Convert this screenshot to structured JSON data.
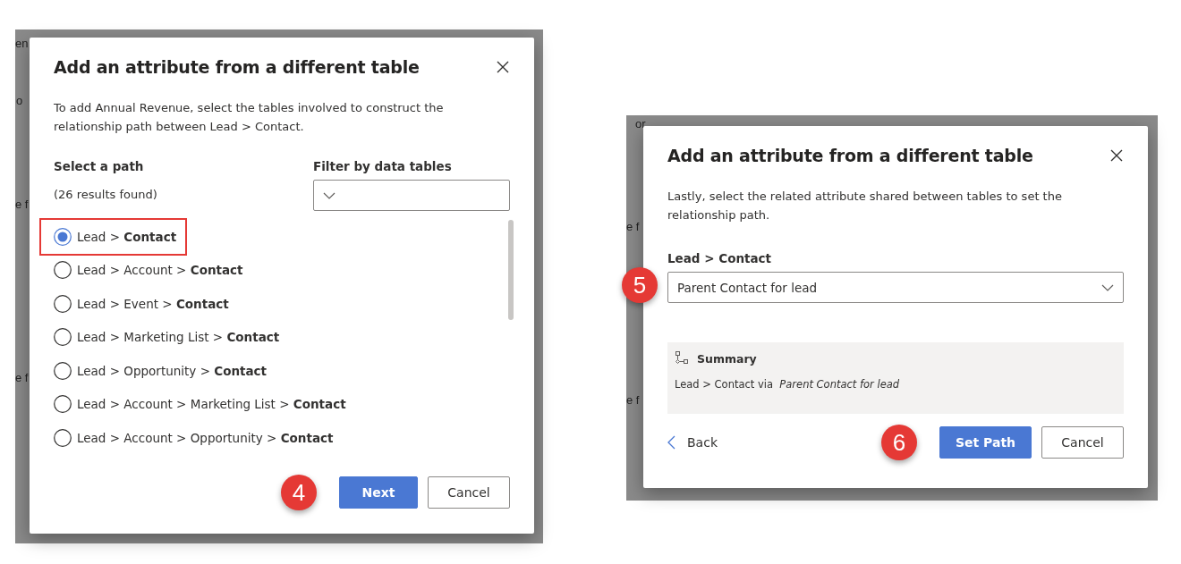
{
  "step_one": {
    "backdrop": {
      "fragments": [
        "en",
        "o",
        "e f",
        "e f"
      ]
    },
    "dialog": {
      "title": "Add an attribute from a different table",
      "description": "To add Annual Revenue, select the tables involved to construct the relationship path between Lead > Contact.",
      "path_label": "Select a path",
      "results": "(26 results found)",
      "filter": {
        "label": "Filter by data tables"
      },
      "paths": [
        {
          "label": "Lead > **Contact**",
          "selected": true,
          "highlighted": true
        },
        {
          "label": "Lead > Account > **Contact**",
          "selected": false,
          "highlighted": false
        },
        {
          "label": "Lead > Event > **Contact**",
          "selected": false,
          "highlighted": false
        },
        {
          "label": "Lead > Marketing List > **Contact**",
          "selected": false,
          "highlighted": false
        },
        {
          "label": "Lead > Opportunity > **Contact**",
          "selected": false,
          "highlighted": false
        },
        {
          "label": "Lead > Account > Marketing List > **Contact**",
          "selected": false,
          "highlighted": false
        },
        {
          "label": "Lead > Account > Opportunity > **Contact**",
          "selected": false,
          "highlighted": false
        }
      ],
      "step_badge": "4",
      "buttons": [
        "Next",
        "Cancel"
      ]
    }
  },
  "step_two": {
    "backdrop": {
      "fragments": [
        "or",
        "e f",
        "e f"
      ]
    },
    "dialog": {
      "title": "Add an attribute from a different table",
      "description": "Lastly, select the related attribute shared between tables to set the relationship path.",
      "field_label": "Lead > Contact",
      "field_badge": "5",
      "field_value": "Parent Contact for lead",
      "summary": {
        "title": "Summary",
        "text": "Lead > Contact via",
        "attribute": "Parent Contact for lead"
      },
      "back": "Back",
      "step_badge": "6",
      "buttons": [
        "Set Path",
        "Cancel"
      ]
    }
  }
}
